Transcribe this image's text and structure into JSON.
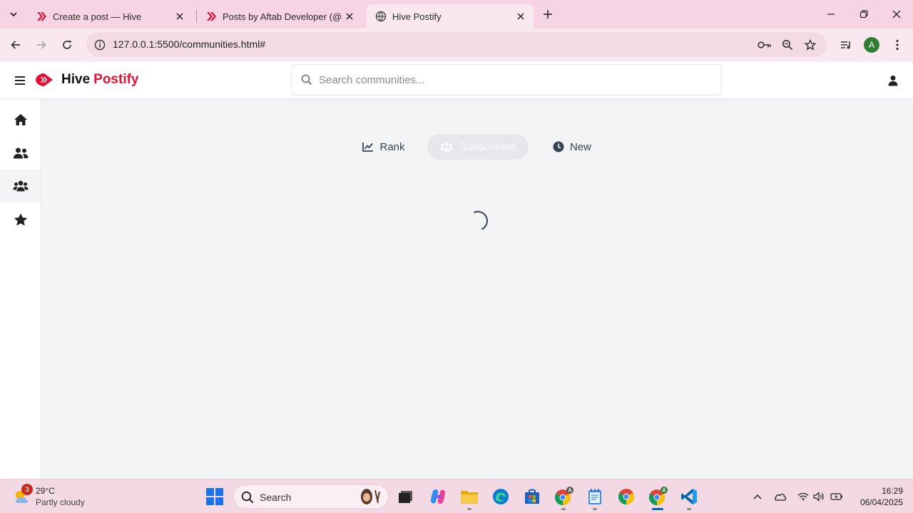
{
  "browser": {
    "tabs": [
      {
        "title": "Create a post — Hive"
      },
      {
        "title": "Posts by Aftab Developer (@aft"
      },
      {
        "title": "Hive Postify"
      }
    ],
    "url": "127.0.0.1:5500/communities.html#",
    "profile_initial": "A",
    "theme_color": "#f6d4e3"
  },
  "app": {
    "brand_part1": "Hive",
    "brand_part2": "Postify",
    "brand_color": "#e31337",
    "search_placeholder": "Search communities...",
    "sidebar": [
      {
        "icon": "home-icon",
        "active": false
      },
      {
        "icon": "user-friends-icon",
        "active": false
      },
      {
        "icon": "users-icon",
        "active": true
      },
      {
        "icon": "star-icon",
        "active": false
      }
    ],
    "filters": [
      {
        "label": "Rank",
        "icon": "chart-line-icon",
        "state": "normal"
      },
      {
        "label": "Subscribers",
        "icon": "users-icon",
        "state": "disabled"
      },
      {
        "label": "New",
        "icon": "clock-icon",
        "state": "normal"
      }
    ],
    "loading": true
  },
  "taskbar": {
    "weather_temp": "29°C",
    "weather_condition": "Partly cloudy",
    "weather_badge": "3",
    "search_label": "Search",
    "time": "16:29",
    "date": "06/04/2025"
  }
}
